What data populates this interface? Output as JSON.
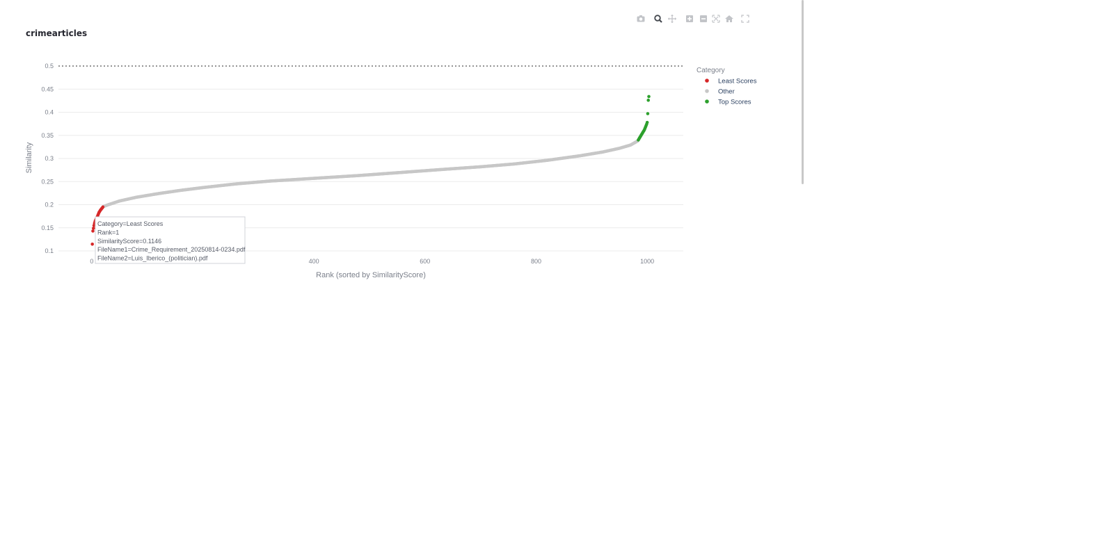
{
  "toolbar": {
    "icons": [
      "camera-icon",
      "zoom-icon",
      "pan-icon",
      "zoom-in-icon",
      "zoom-out-icon",
      "autoscale-icon",
      "reset-axes-icon",
      "fullscreen-icon"
    ],
    "active": "zoom-icon"
  },
  "chart_data": {
    "type": "scatter",
    "title": "crimearticles",
    "xlabel": "Rank (sorted by SimilarityScore)",
    "ylabel": "Similarity",
    "xlim": [
      -60,
      1065
    ],
    "ylim": [
      0.1,
      0.5
    ],
    "x_ticks": [
      0,
      400,
      600,
      800,
      1000
    ],
    "y_ticks": [
      0.1,
      0.15,
      0.2,
      0.25,
      0.3,
      0.35,
      0.4,
      0.45,
      0.5
    ],
    "y_tick_labels": [
      "0.1",
      "0.15",
      "0.2",
      "0.25",
      "0.3",
      "0.35",
      "0.4",
      "0.45",
      "0.5"
    ],
    "x_tick_labels": [
      "0",
      "400",
      "600",
      "800",
      "1000"
    ],
    "grid": true,
    "reference_line": {
      "y": 0.5,
      "style": "dotted",
      "color": "#555555"
    },
    "legend": {
      "title": "Category",
      "placement": "top-right",
      "entries": [
        {
          "name": "Least Scores",
          "color": "#d62728"
        },
        {
          "name": "Other",
          "color": "#c7c7c7"
        },
        {
          "name": "Top Scores",
          "color": "#2ca02c"
        }
      ]
    },
    "series": [
      {
        "name": "Least Scores",
        "color": "#d62728",
        "x": [
          1,
          2,
          3,
          4,
          5,
          6,
          7,
          8,
          9,
          10,
          11,
          12,
          13,
          14,
          15,
          16,
          17,
          18,
          19,
          20
        ],
        "y": [
          0.1146,
          0.143,
          0.149,
          0.155,
          0.16,
          0.164,
          0.167,
          0.17,
          0.172,
          0.174,
          0.177,
          0.18,
          0.183,
          0.185,
          0.187,
          0.189,
          0.19,
          0.192,
          0.193,
          0.195
        ]
      },
      {
        "name": "Other",
        "color": "#c7c7c7",
        "curve_knots_x": [
          21,
          30,
          50,
          80,
          120,
          160,
          200,
          260,
          320,
          400,
          480,
          560,
          640,
          700,
          760,
          820,
          880,
          920,
          950,
          970,
          983
        ],
        "curve_knots_y": [
          0.196,
          0.2,
          0.208,
          0.216,
          0.224,
          0.231,
          0.237,
          0.245,
          0.251,
          0.257,
          0.263,
          0.27,
          0.277,
          0.282,
          0.288,
          0.296,
          0.306,
          0.314,
          0.322,
          0.329,
          0.338
        ]
      },
      {
        "name": "Top Scores",
        "color": "#2ca02c",
        "x": [
          984,
          985,
          986,
          987,
          988,
          989,
          990,
          991,
          992,
          993,
          994,
          995,
          996,
          997,
          998,
          999,
          1000,
          1001,
          1002,
          1003
        ],
        "y": [
          0.34,
          0.342,
          0.344,
          0.346,
          0.348,
          0.35,
          0.352,
          0.354,
          0.356,
          0.358,
          0.36,
          0.362,
          0.365,
          0.368,
          0.371,
          0.374,
          0.378,
          0.397,
          0.426,
          0.434
        ]
      }
    ],
    "hover": {
      "lines": [
        "Category=Least Scores",
        "Rank=1",
        "SimilarityScore=0.1146",
        "FileName1=Crime_Requirement_20250814-0234.pdf",
        "FileName2=Luis_Iberico_(politician).pdf"
      ]
    }
  }
}
